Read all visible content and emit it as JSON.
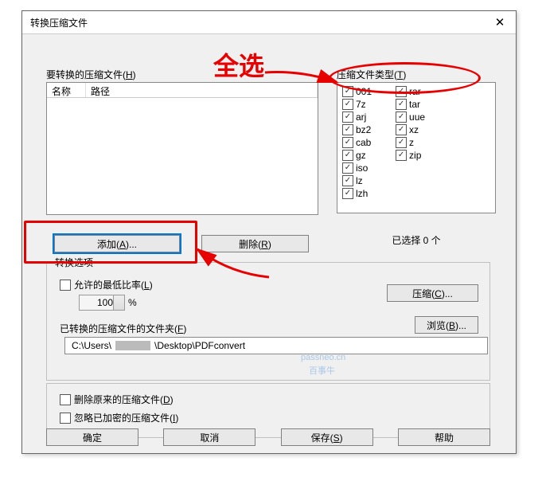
{
  "dialog": {
    "title": "转换压缩文件",
    "close_x": "✕"
  },
  "files": {
    "label_prefix": "要转换的压缩文件(",
    "label_hotkey": "H",
    "label_suffix": ")",
    "col_name": "名称",
    "col_path": "路径"
  },
  "types": {
    "label_prefix": "压缩文件类型(",
    "label_hotkey": "T",
    "label_suffix": ")",
    "left": [
      "001",
      "7z",
      "arj",
      "bz2",
      "cab",
      "gz",
      "iso",
      "lz",
      "lzh"
    ],
    "right": [
      "rar",
      "tar",
      "uue",
      "xz",
      "z",
      "zip"
    ],
    "selected_count": "已选择 0 个"
  },
  "buttons": {
    "add": "添加(A)...",
    "delete": "删除(R)",
    "compress": "压缩(C)...",
    "browse": "浏览(B)...",
    "ok": "确定",
    "cancel": "取消",
    "save": "保存(S)",
    "help": "帮助"
  },
  "options": {
    "group_title": "转换选项",
    "ratio_label": "允许的最低比率(L)",
    "ratio_value": "100",
    "ratio_pct": "%",
    "folder_label": "已转换的压缩文件的文件夹(F)",
    "folder_path_prefix": "C:\\Users\\",
    "folder_path_suffix": "\\Desktop\\PDFconvert"
  },
  "group2": {
    "delete_original": "删除原来的压缩文件(D)",
    "ignore_encrypted": "忽略已加密的压缩文件(I)"
  },
  "annotation": {
    "select_all": "全选"
  },
  "watermark": {
    "l1": "passneo.cn",
    "l2": "百事牛"
  },
  "colors": {
    "accent_red": "#e60000"
  }
}
